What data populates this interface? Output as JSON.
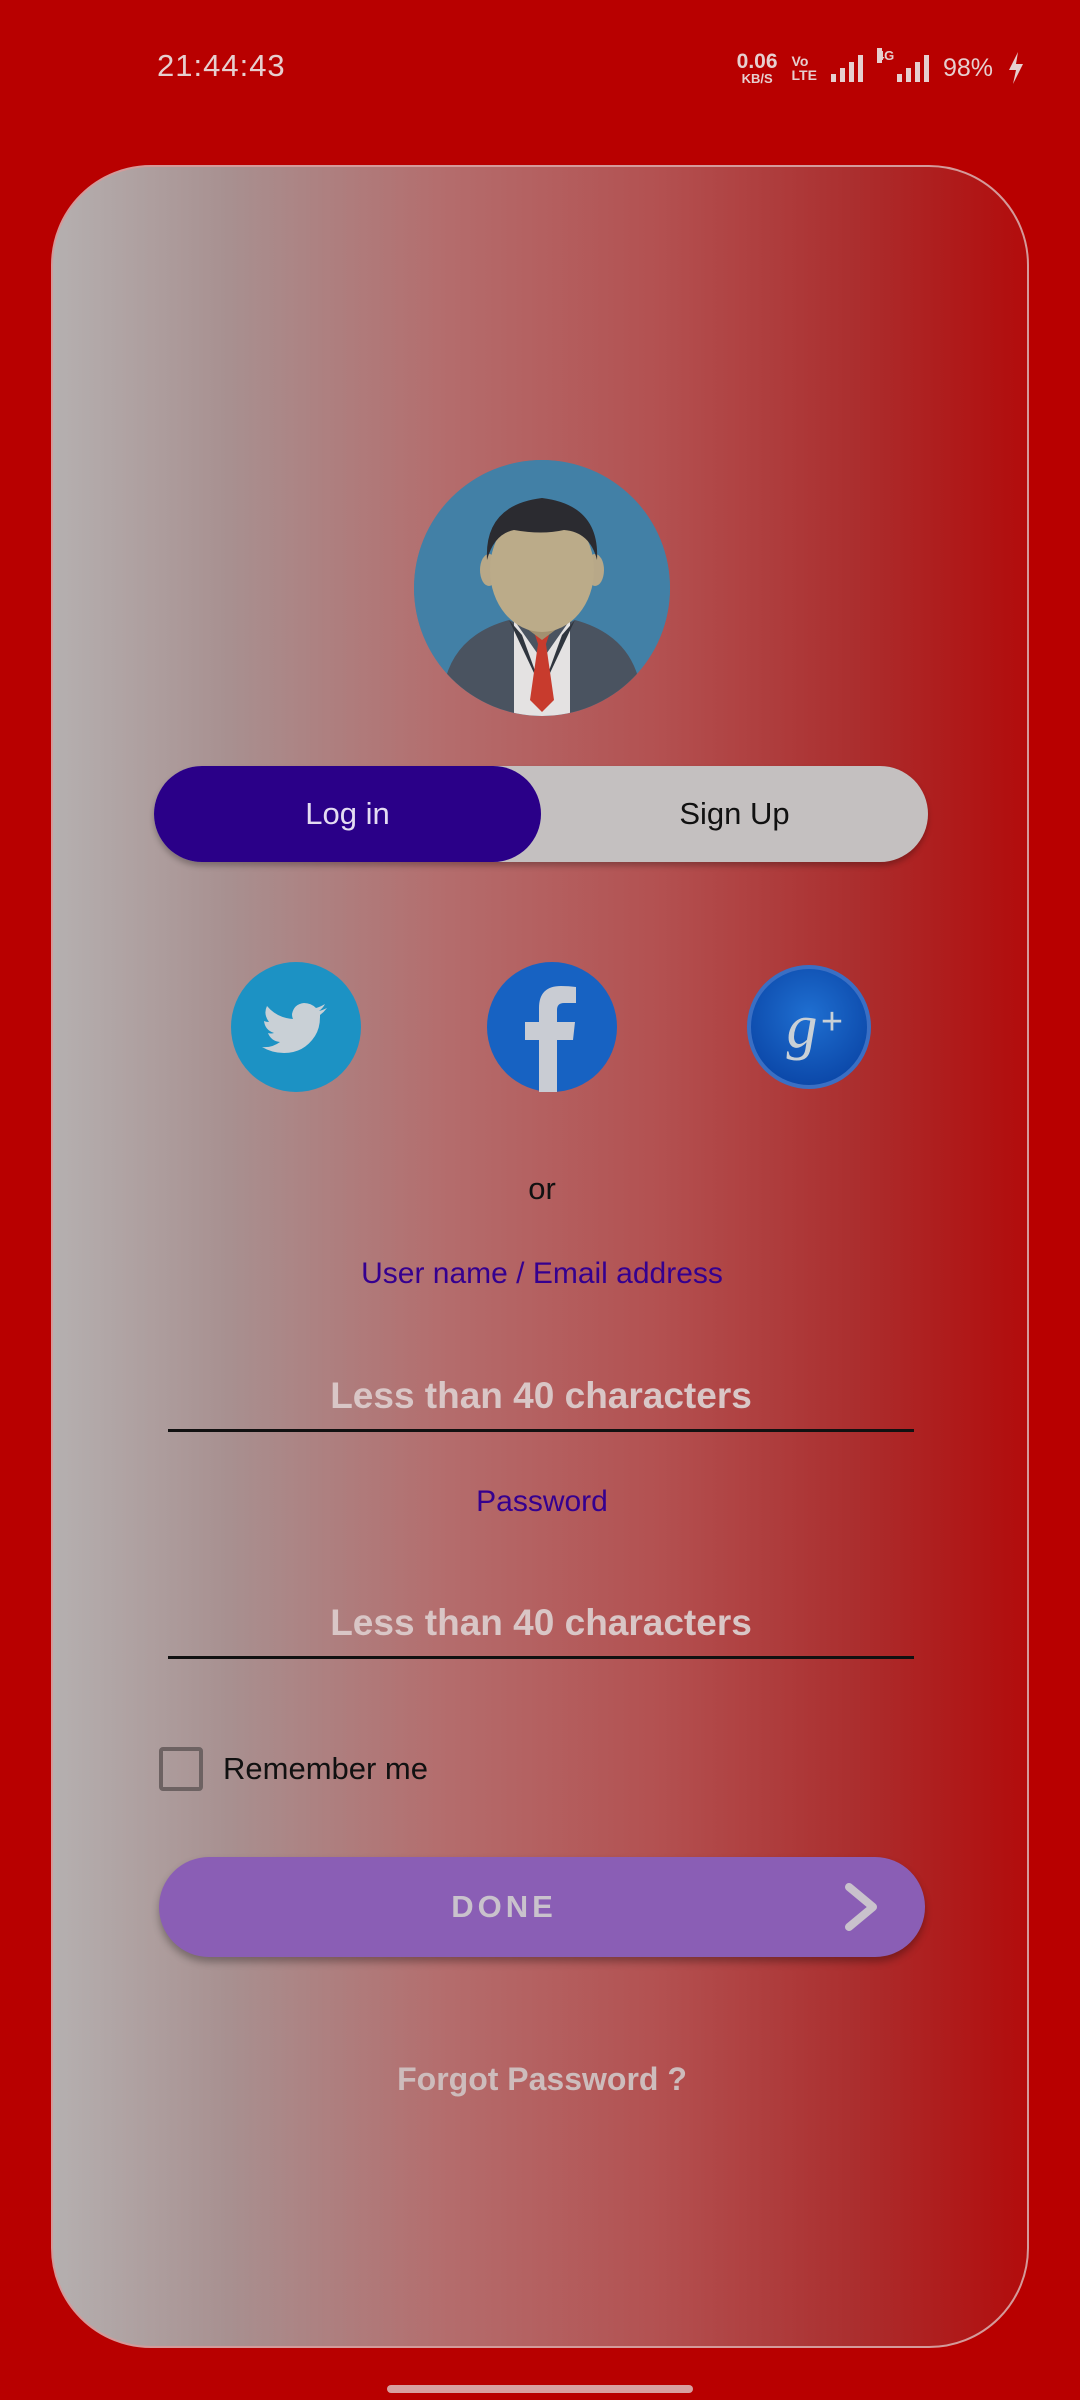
{
  "status_bar": {
    "time": "21:44:43",
    "net_speed_value": "0.06",
    "net_speed_unit": "KB/S",
    "volte_top": "Vo",
    "volte_bottom": "LTE",
    "network_4g": "4G",
    "battery": "98%"
  },
  "auth_toggle": {
    "login_label": "Log in",
    "signup_label": "Sign Up",
    "active": "Log in"
  },
  "social": {
    "twitter_icon": "twitter-icon",
    "facebook_icon": "facebook-icon",
    "google_plus_icon": "google-plus-icon"
  },
  "separator": "or",
  "form": {
    "username_label": "User name / Email address",
    "username_placeholder": "Less than 40 characters",
    "username_value": "",
    "password_label": "Password",
    "password_placeholder": "Less than 40 characters",
    "password_value": "",
    "remember_label": "Remember me",
    "remember_checked": false,
    "done_label": "DONE",
    "forgot_label": "Forgot Password ?"
  },
  "colors": {
    "background": "#b80000",
    "toggle_active": "#2a0088",
    "done_button": "#8a5eb5",
    "label_text": "#35008f"
  }
}
